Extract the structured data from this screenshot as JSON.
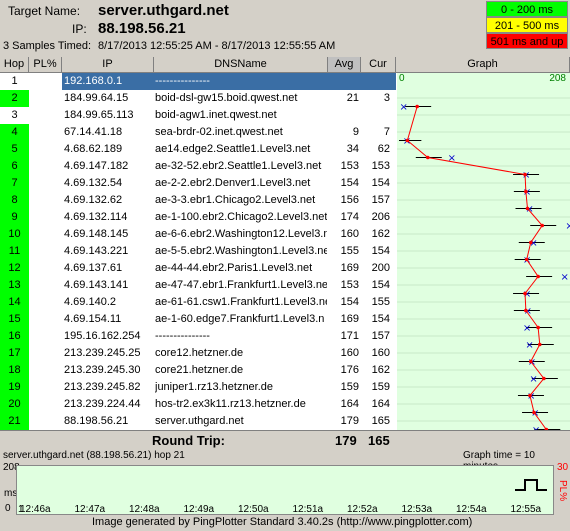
{
  "header": {
    "target_label": "Target Name:",
    "target_value": "server.uthgard.net",
    "ip_label": "IP:",
    "ip_value": "88.198.56.21",
    "samples_label": "3 Samples Timed:",
    "samples_value": "8/17/2013 12:55:25 AM - 8/17/2013 12:55:55 AM"
  },
  "legend": [
    {
      "label": "0 - 200 ms",
      "color": "#00ff00"
    },
    {
      "label": "201 - 500 ms",
      "color": "#ffff00"
    },
    {
      "label": "501 ms and up",
      "color": "#ff0000"
    }
  ],
  "columns": {
    "hop": "Hop",
    "pl": "PL%",
    "ip": "IP",
    "dns": "DNSName",
    "avg": "Avg",
    "cur": "Cur",
    "graph": "Graph"
  },
  "graph_scale": {
    "min": "0",
    "max": "208"
  },
  "hops": [
    {
      "hop": "1",
      "pl": "",
      "ip": "192.168.0.1",
      "dns": "---------------",
      "avg": "",
      "cur": "",
      "selected": true,
      "plcolor": "#ffffff"
    },
    {
      "hop": "2",
      "pl": "",
      "ip": "184.99.64.15",
      "dns": "boid-dsl-gw15.boid.qwest.net",
      "avg": "21",
      "cur": "3",
      "plcolor": "#00ff00"
    },
    {
      "hop": "3",
      "pl": "",
      "ip": "184.99.65.113",
      "dns": "boid-agw1.inet.qwest.net",
      "avg": "",
      "cur": "",
      "plcolor": "#ffffff"
    },
    {
      "hop": "4",
      "pl": "",
      "ip": "67.14.41.18",
      "dns": "sea-brdr-02.inet.qwest.net",
      "avg": "9",
      "cur": "7",
      "plcolor": "#00ff00"
    },
    {
      "hop": "5",
      "pl": "",
      "ip": "4.68.62.189",
      "dns": "ae14.edge2.Seattle1.Level3.net",
      "avg": "34",
      "cur": "62",
      "plcolor": "#00ff00"
    },
    {
      "hop": "6",
      "pl": "",
      "ip": "4.69.147.182",
      "dns": "ae-32-52.ebr2.Seattle1.Level3.net",
      "avg": "153",
      "cur": "153",
      "plcolor": "#00ff00"
    },
    {
      "hop": "7",
      "pl": "",
      "ip": "4.69.132.54",
      "dns": "ae-2-2.ebr2.Denver1.Level3.net",
      "avg": "154",
      "cur": "154",
      "plcolor": "#00ff00"
    },
    {
      "hop": "8",
      "pl": "",
      "ip": "4.69.132.62",
      "dns": "ae-3-3.ebr1.Chicago2.Level3.net",
      "avg": "156",
      "cur": "157",
      "plcolor": "#00ff00"
    },
    {
      "hop": "9",
      "pl": "",
      "ip": "4.69.132.114",
      "dns": "ae-1-100.ebr2.Chicago2.Level3.net",
      "avg": "174",
      "cur": "206",
      "plcolor": "#00ff00"
    },
    {
      "hop": "10",
      "pl": "",
      "ip": "4.69.148.145",
      "dns": "ae-6-6.ebr2.Washington12.Level3.n",
      "avg": "160",
      "cur": "162",
      "plcolor": "#00ff00"
    },
    {
      "hop": "11",
      "pl": "",
      "ip": "4.69.143.221",
      "dns": "ae-5-5.ebr2.Washington1.Level3.ne",
      "avg": "155",
      "cur": "154",
      "plcolor": "#00ff00"
    },
    {
      "hop": "12",
      "pl": "",
      "ip": "4.69.137.61",
      "dns": "ae-44-44.ebr2.Paris1.Level3.net",
      "avg": "169",
      "cur": "200",
      "plcolor": "#00ff00"
    },
    {
      "hop": "13",
      "pl": "",
      "ip": "4.69.143.141",
      "dns": "ae-47-47.ebr1.Frankfurt1.Level3.ne",
      "avg": "153",
      "cur": "154",
      "plcolor": "#00ff00"
    },
    {
      "hop": "14",
      "pl": "",
      "ip": "4.69.140.2",
      "dns": "ae-61-61.csw1.Frankfurt1.Level3.ne",
      "avg": "154",
      "cur": "155",
      "plcolor": "#00ff00"
    },
    {
      "hop": "15",
      "pl": "",
      "ip": "4.69.154.11",
      "dns": "ae-1-60.edge7.Frankfurt1.Level3.n",
      "avg": "169",
      "cur": "154",
      "plcolor": "#00ff00"
    },
    {
      "hop": "16",
      "pl": "",
      "ip": "195.16.162.254",
      "dns": "---------------",
      "avg": "171",
      "cur": "157",
      "plcolor": "#00ff00"
    },
    {
      "hop": "17",
      "pl": "",
      "ip": "213.239.245.25",
      "dns": "core12.hetzner.de",
      "avg": "160",
      "cur": "160",
      "plcolor": "#00ff00"
    },
    {
      "hop": "18",
      "pl": "",
      "ip": "213.239.245.30",
      "dns": "core21.hetzner.de",
      "avg": "176",
      "cur": "162",
      "plcolor": "#00ff00"
    },
    {
      "hop": "19",
      "pl": "",
      "ip": "213.239.245.82",
      "dns": "juniper1.rz13.hetzner.de",
      "avg": "159",
      "cur": "159",
      "plcolor": "#00ff00"
    },
    {
      "hop": "20",
      "pl": "",
      "ip": "213.239.224.44",
      "dns": "hos-tr2.ex3k11.rz13.hetzner.de",
      "avg": "164",
      "cur": "164",
      "plcolor": "#00ff00"
    },
    {
      "hop": "21",
      "pl": "",
      "ip": "88.198.56.21",
      "dns": "server.uthgard.net",
      "avg": "179",
      "cur": "165",
      "plcolor": "#00ff00"
    }
  ],
  "roundtrip": {
    "label": "Round Trip:",
    "avg": "179",
    "cur": "165"
  },
  "timeline": {
    "title": "server.uthgard.net (88.198.56.21) hop 21",
    "graph_time": "Graph time = 10 minutes",
    "y_max": "208",
    "y_zero": "0",
    "y_unit": "ms",
    "pl_max": "30",
    "pl_label": "PL%",
    "ticks": [
      "12:46a",
      "12:47a",
      "12:48a",
      "12:49a",
      "12:50a",
      "12:51a",
      "12:52a",
      "12:53a",
      "12:54a",
      "12:55a"
    ],
    "tick_lead": "1"
  },
  "footer": "Image generated by PingPlotter Standard 3.40.2s (http://www.pingplotter.com)"
}
